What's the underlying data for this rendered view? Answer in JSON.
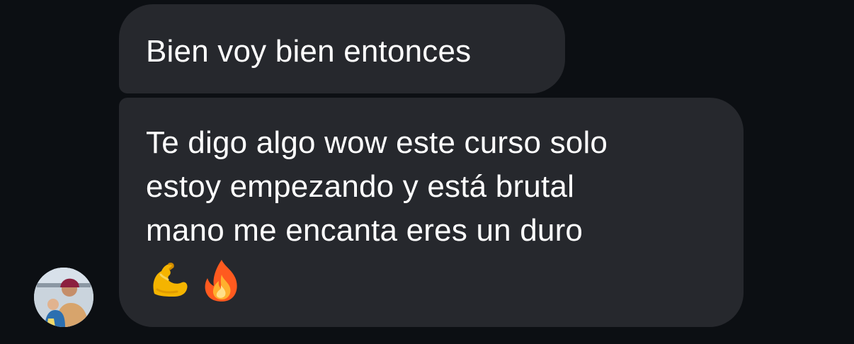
{
  "conversation": {
    "messages": [
      {
        "lines": [
          "Bien voy bien entonces"
        ],
        "emojis": []
      },
      {
        "lines": [
          "Te digo algo wow este curso solo",
          "estoy empezando y está brutal",
          "mano me encanta eres un duro"
        ],
        "emojis": [
          "💪",
          "🔥"
        ]
      }
    ],
    "sender": {
      "avatar_icon": "user-avatar"
    }
  }
}
